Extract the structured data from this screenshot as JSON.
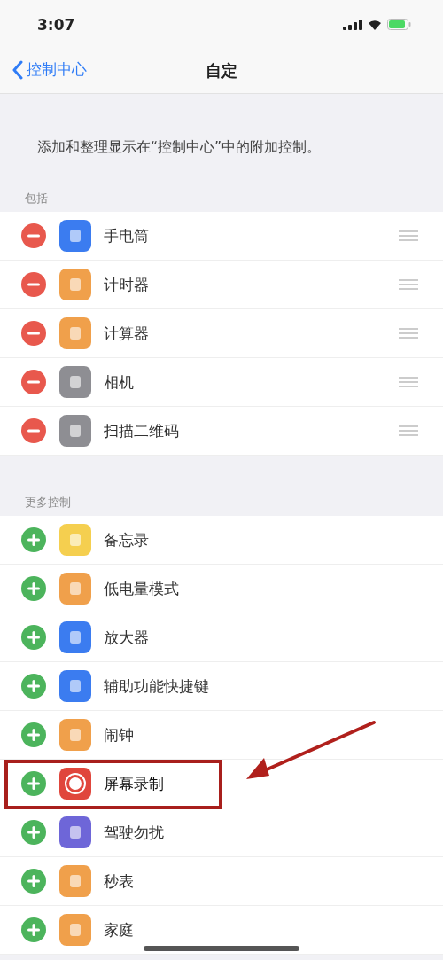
{
  "status_bar": {
    "time": "3:07"
  },
  "nav": {
    "back": "控制中心",
    "title": "自定"
  },
  "description": "添加和整理显示在“控制中心”中的附加控制。",
  "sections": [
    {
      "header": "包括",
      "kind": "included",
      "items": [
        {
          "label": "手电筒",
          "color": "#3b7cf0",
          "highlighted": false
        },
        {
          "label": "计时器",
          "color": "#f0a04b",
          "highlighted": false
        },
        {
          "label": "计算器",
          "color": "#f0a04b",
          "highlighted": false
        },
        {
          "label": "相机",
          "color": "#8e8e93",
          "highlighted": false
        },
        {
          "label": "扫描二维码",
          "color": "#8e8e93",
          "highlighted": false
        }
      ]
    },
    {
      "header": "更多控制",
      "kind": "more",
      "items": [
        {
          "label": "备忘录",
          "color": "#f5cf4f",
          "highlighted": false
        },
        {
          "label": "低电量模式",
          "color": "#f0a04b",
          "highlighted": false
        },
        {
          "label": "放大器",
          "color": "#3b7cf0",
          "highlighted": false
        },
        {
          "label": "辅助功能快捷键",
          "color": "#3b7cf0",
          "highlighted": false
        },
        {
          "label": "闹钟",
          "color": "#f0a04b",
          "highlighted": false
        },
        {
          "label": "屏幕录制",
          "color": "#e0463c",
          "highlighted": true
        },
        {
          "label": "驾驶勿扰",
          "color": "#6e66d8",
          "highlighted": false
        },
        {
          "label": "秒表",
          "color": "#f0a04b",
          "highlighted": false
        },
        {
          "label": "家庭",
          "color": "#f0a04b",
          "highlighted": false
        }
      ]
    }
  ]
}
